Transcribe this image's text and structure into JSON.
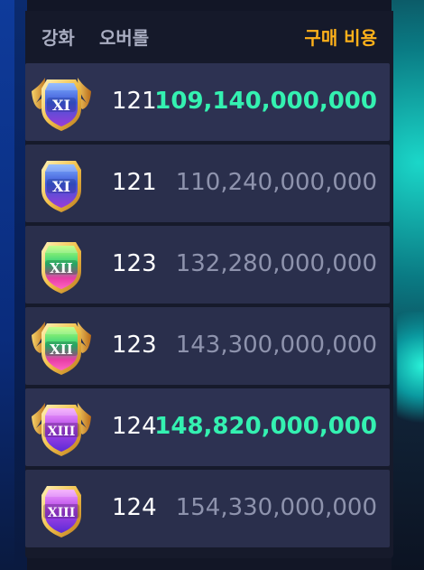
{
  "header": {
    "col_enhance": "강화",
    "col_overall": "오버롤",
    "col_cost": "구매 비용"
  },
  "rows": [
    {
      "tier": "XI",
      "overall": "121",
      "cost": "109,140,000,000",
      "highlight": true,
      "badge_style": "winged"
    },
    {
      "tier": "XI",
      "overall": "121",
      "cost": "110,240,000,000",
      "highlight": false,
      "badge_style": "plain"
    },
    {
      "tier": "XII",
      "overall": "123",
      "cost": "132,280,000,000",
      "highlight": false,
      "badge_style": "plain"
    },
    {
      "tier": "XII",
      "overall": "123",
      "cost": "143,300,000,000",
      "highlight": false,
      "badge_style": "winged"
    },
    {
      "tier": "XIII",
      "overall": "124",
      "cost": "148,820,000,000",
      "highlight": true,
      "badge_style": "winged"
    },
    {
      "tier": "XIII",
      "overall": "124",
      "cost": "154,330,000,000",
      "highlight": false,
      "badge_style": "plain"
    }
  ],
  "colors": {
    "accent_header": "#ffb11a",
    "cost_highlight": "#34f1b1",
    "cost_normal": "#8e93ad",
    "row_bg": "#2a2f4c",
    "panel_bg": "#161a2b"
  },
  "icons": {
    "badge_xi": "shield-badge-xi-icon",
    "badge_xii": "shield-badge-xii-icon",
    "badge_xiii": "shield-badge-xiii-icon"
  }
}
